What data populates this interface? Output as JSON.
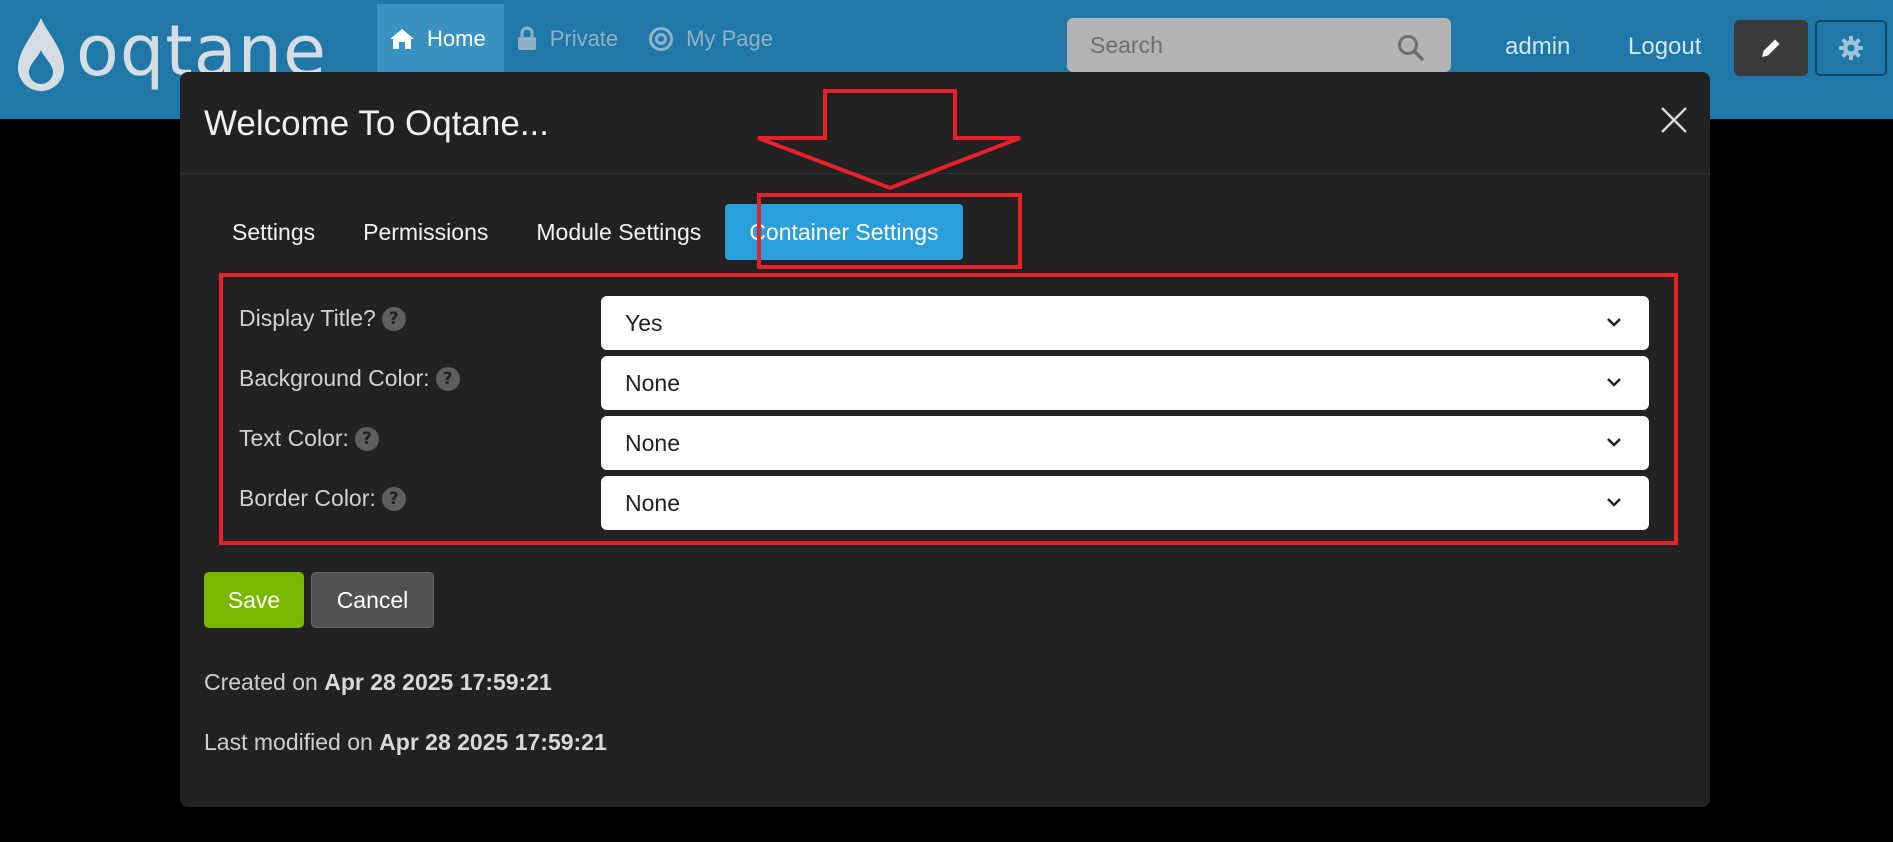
{
  "app": {
    "logo_text": "oqtane"
  },
  "nav": {
    "items": [
      {
        "label": "Home",
        "icon": "home-icon",
        "active": true
      },
      {
        "label": "Private",
        "icon": "lock-icon",
        "active": false
      },
      {
        "label": "My Page",
        "icon": "target-icon",
        "active": false
      }
    ]
  },
  "search": {
    "placeholder": "Search"
  },
  "user": {
    "username": "admin",
    "logout_label": "Logout"
  },
  "modal": {
    "title": "Welcome To Oqtane...",
    "tabs": [
      {
        "label": "Settings"
      },
      {
        "label": "Permissions"
      },
      {
        "label": "Module Settings"
      },
      {
        "label": "Container Settings",
        "active": true
      }
    ],
    "fields": [
      {
        "label": "Display Title?",
        "value": "Yes"
      },
      {
        "label": "Background Color:",
        "value": "None"
      },
      {
        "label": "Text Color:",
        "value": "None"
      },
      {
        "label": "Border Color:",
        "value": "None"
      }
    ],
    "save_label": "Save",
    "cancel_label": "Cancel",
    "created_prefix": "Created on",
    "created_value": "Apr 28 2025 17:59:21",
    "modified_prefix": "Last modified on",
    "modified_value": "Apr 28 2025 17:59:21"
  },
  "colors": {
    "topbar": "#1f78a8",
    "active_tab": "#29a0dc",
    "save_button": "#7ab800",
    "annotation": "#e8202a"
  }
}
